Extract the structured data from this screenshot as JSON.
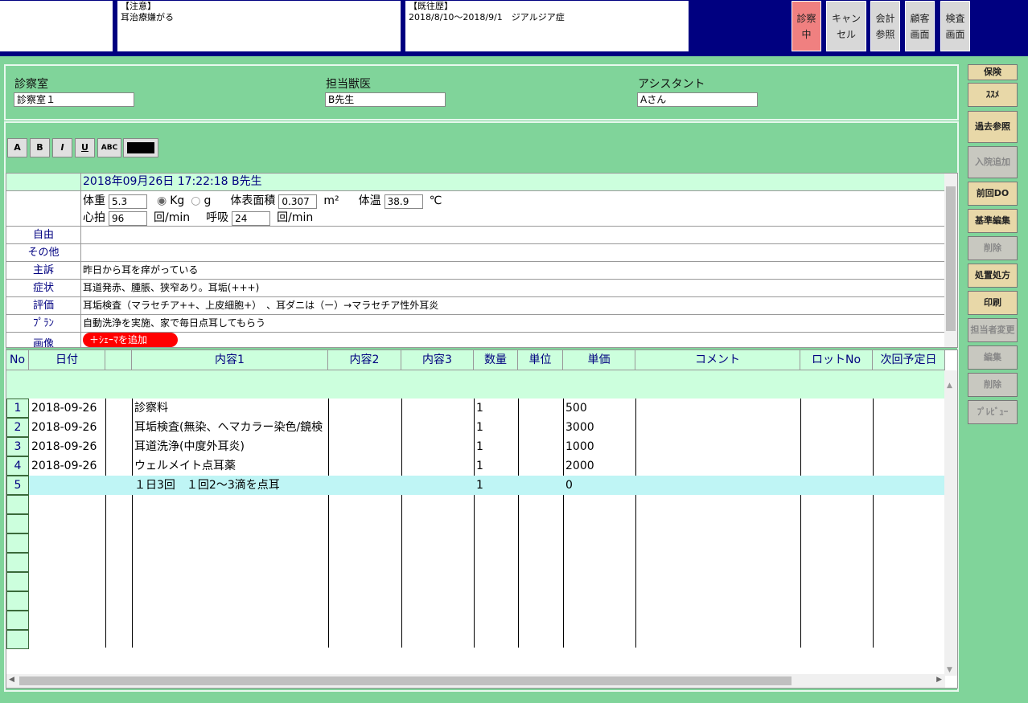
{
  "top": {
    "caution_label": "【注意】",
    "caution_text": "耳治療嫌がる",
    "history_label": "【既往歴】",
    "history_text": "2018/8/10～2018/9/1　ジアルジア症",
    "buttons": [
      "診察\n中",
      "キャン\nセル",
      "会計\n参照",
      "顧客\n画面",
      "検査\n画面"
    ]
  },
  "info": {
    "room_label": "診察室",
    "room_value": "診察室１",
    "doctor_label": "担当獣医",
    "doctor_value": "B先生",
    "assistant_label": "アシスタント",
    "assistant_value": "Aさん"
  },
  "format_buttons": [
    "A",
    "B",
    "I",
    "U",
    "ABC"
  ],
  "karte": {
    "header": "2018年09月26日 17:22:18 B先生",
    "vitals": {
      "weight_label": "体重",
      "weight": "5.3",
      "unit_kg": "Kg",
      "unit_g": "g",
      "bsa_label": "体表面積",
      "bsa": "0.307",
      "bsa_unit": "m²",
      "temp_label": "体温",
      "temp": "38.9",
      "temp_unit": "℃",
      "hr_label": "心拍",
      "hr": "96",
      "hr_unit": "回/min",
      "rr_label": "呼吸",
      "rr": "24",
      "rr_unit": "回/min"
    },
    "rows": [
      {
        "label": "自由",
        "value": ""
      },
      {
        "label": "その他",
        "value": ""
      },
      {
        "label": "主訴",
        "value": "昨日から耳を痒がっている"
      },
      {
        "label": "症状",
        "value": "耳道発赤、腫脹、狭窄あり。耳垢(+++)"
      },
      {
        "label": "評価",
        "value": "耳垢検査（マラセチア++、上皮細胞+）　、耳ダニは（ー）→マラセチア性外耳炎"
      },
      {
        "label": "ﾌﾟﾗﾝ",
        "value": "自動洗浄を実施、家で毎日点耳してもらう"
      },
      {
        "label": "画像",
        "value": ""
      }
    ],
    "schema_button": "＋ｼｪｰﾏを追加"
  },
  "grid": {
    "headers": [
      "No",
      "日付",
      "",
      "内容1",
      "内容2",
      "内容3",
      "数量",
      "単位",
      "単価",
      "コメント",
      "ロットNo",
      "次回予定日"
    ],
    "rows": [
      {
        "no": "1",
        "date": "2018-09-26",
        "content": "診察料",
        "qty": "1",
        "price": "500"
      },
      {
        "no": "2",
        "date": "2018-09-26",
        "content": "耳垢検査(無染、ヘマカラー染色/鏡検",
        "qty": "1",
        "price": "3000"
      },
      {
        "no": "3",
        "date": "2018-09-26",
        "content": "耳道洗浄(中度外耳炎)",
        "qty": "1",
        "price": "1000"
      },
      {
        "no": "4",
        "date": "2018-09-26",
        "content": "ウェルメイト点耳薬",
        "qty": "1",
        "price": "2000"
      },
      {
        "no": "5",
        "date": "",
        "content": "１日3回　１回2～3滴を点耳",
        "qty": "1",
        "price": "0"
      }
    ]
  },
  "side_buttons": [
    "保険",
    "ｽｽﾒ",
    "過去参照",
    "入院追加",
    "前回DO",
    "基準編集",
    "削除",
    "処置処方",
    "印刷",
    "担当者変更",
    "編集",
    "削除",
    "ﾌﾟﾚﾋﾞｭｰ"
  ]
}
